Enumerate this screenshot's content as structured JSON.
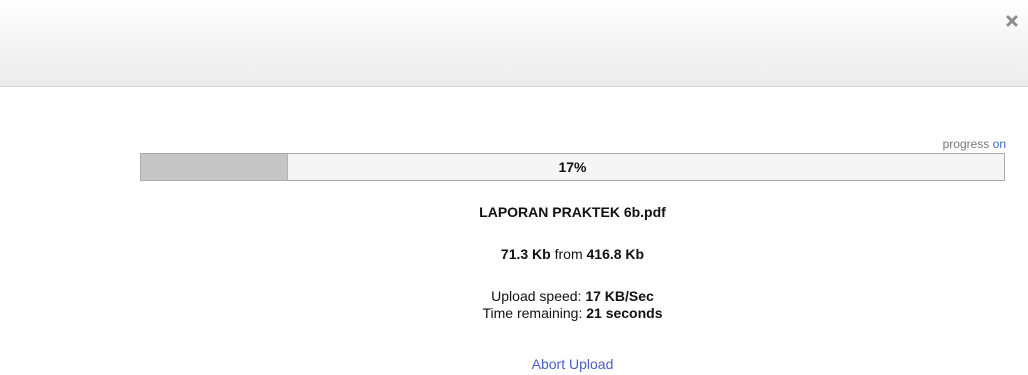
{
  "dialog": {
    "close_icon": "close-icon"
  },
  "progress": {
    "toggle_label": "progress",
    "toggle_state": "on",
    "percent": 17,
    "percent_text": "17%"
  },
  "file": {
    "name": "LAPORAN PRAKTEK 6b.pdf",
    "uploaded": "71.3 Kb",
    "from_word": "from",
    "total": "416.8 Kb"
  },
  "stats": {
    "speed_label": "Upload speed:",
    "speed_value": "17 KB/Sec",
    "remaining_label": "Time remaining:",
    "remaining_value": "21 seconds"
  },
  "actions": {
    "abort_label": "Abort Upload"
  },
  "colors": {
    "progress_fill": "#c6c6c6",
    "link": "#4c5ec4"
  }
}
